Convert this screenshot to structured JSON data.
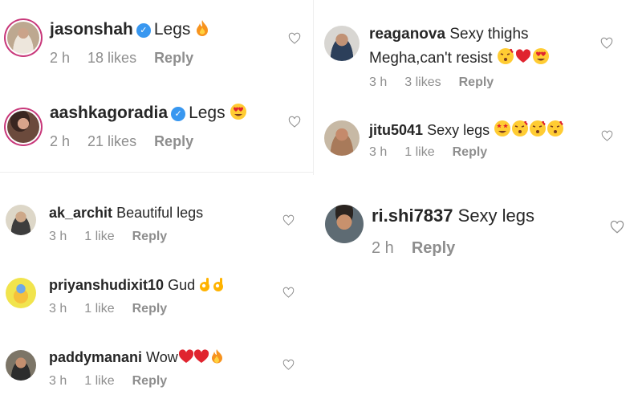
{
  "comments_left_top": [
    {
      "username": "jasonshah",
      "verified": true,
      "text": "Legs",
      "emoji": "fire",
      "age": "2 h",
      "likes": "18 likes",
      "reply": "Reply"
    },
    {
      "username": "aashkagoradia",
      "verified": true,
      "text": "Legs",
      "emoji": "heart-eyes",
      "age": "2 h",
      "likes": "21 likes",
      "reply": "Reply"
    }
  ],
  "comments_left_bottom": [
    {
      "username": "ak_archit",
      "text": "Beautiful legs",
      "age": "3 h",
      "likes": "1 like",
      "reply": "Reply"
    },
    {
      "username": "priyanshudixit10",
      "text": "Gud",
      "emoji": "ok-hands",
      "age": "3 h",
      "likes": "1 like",
      "reply": "Reply"
    },
    {
      "username": "paddymanani",
      "text": "Wow",
      "emoji": "hearts-fire",
      "age": "3 h",
      "likes": "1 like",
      "reply": "Reply"
    }
  ],
  "comments_right": [
    {
      "username": "reaganova",
      "text": "Sexy thighs",
      "text2": "Megha,can't resist",
      "emoji": "kiss-heart-hearteyes",
      "age": "3 h",
      "likes": "3 likes",
      "reply": "Reply"
    },
    {
      "username": "jitu5041",
      "text": "Sexy legs",
      "emoji": "star-eyes-kisses",
      "age": "3 h",
      "likes": "1 like",
      "reply": "Reply"
    },
    {
      "username": "ri.shi7837",
      "text": "Sexy legs",
      "age": "2 h",
      "reply": "Reply"
    }
  ],
  "colors": {
    "verified": "#3897f0",
    "meta": "#8e8e8e",
    "text": "#262626",
    "heart_red": "#e0242f"
  }
}
